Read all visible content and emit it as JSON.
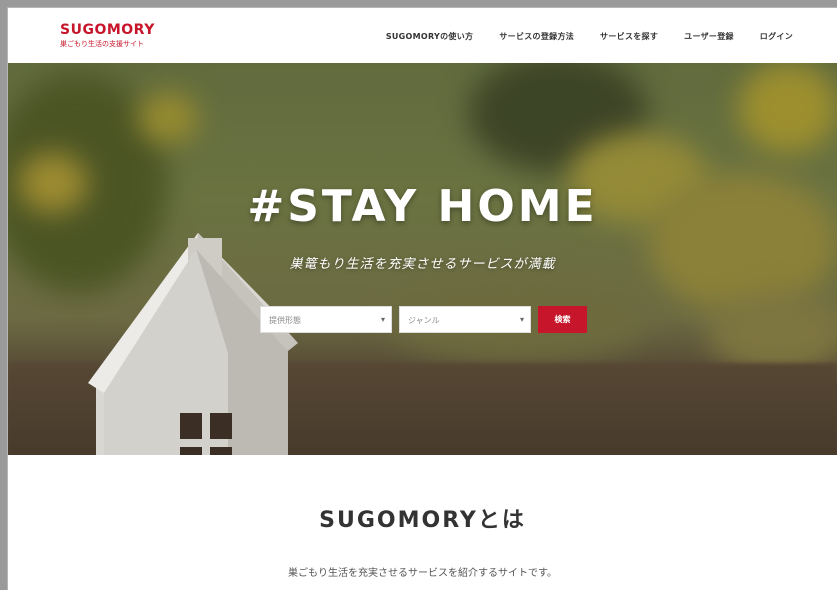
{
  "brand": {
    "name": "SUGOMORY",
    "tagline": "巣ごもり生活の支援サイト"
  },
  "nav": {
    "items": [
      {
        "label": "SUGOMORYの使い方"
      },
      {
        "label": "サービスの登録方法"
      },
      {
        "label": "サービスを探す"
      },
      {
        "label": "ユーザー登録"
      },
      {
        "label": "ログイン"
      }
    ]
  },
  "hero": {
    "title": "#STAY HOME",
    "subtitle": "巣篭もり生活を充実させるサービスが満載",
    "search": {
      "select1": "提供形態",
      "select2": "ジャンル",
      "button": "検索"
    }
  },
  "about": {
    "title": "SUGOMORYとは",
    "text": "巣ごもり生活を充実させるサービスを紹介するサイトです。"
  },
  "colors": {
    "brand": "#c7162b"
  }
}
